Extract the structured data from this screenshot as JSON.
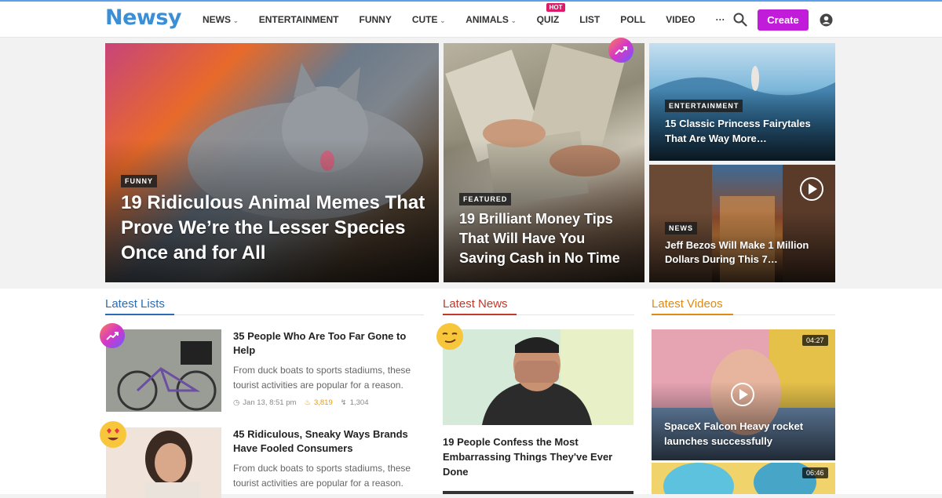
{
  "brand": {
    "logo": "Newsy",
    "accent": "#c11cd9"
  },
  "nav": {
    "items": [
      {
        "label": "NEWS",
        "dropdown": true
      },
      {
        "label": "ENTERTAINMENT",
        "dropdown": false
      },
      {
        "label": "FUNNY",
        "dropdown": false
      },
      {
        "label": "CUTE",
        "dropdown": true
      },
      {
        "label": "ANIMALS",
        "dropdown": true
      },
      {
        "label": "QUIZ",
        "dropdown": false,
        "badge": "HOT"
      },
      {
        "label": "LIST",
        "dropdown": false
      },
      {
        "label": "POLL",
        "dropdown": false
      },
      {
        "label": "VIDEO",
        "dropdown": false
      },
      {
        "label": "···",
        "dropdown": false
      }
    ],
    "create_label": "Create"
  },
  "featured": [
    {
      "category": "FUNNY",
      "title": "19 Ridiculous Animal Memes That Prove We’re the Lesser Species Once and for All"
    },
    {
      "category": "FEATURED",
      "title": "19 Brilliant Money Tips That Will Have You Saving Cash in No Time",
      "icon": "trending-icon"
    },
    {
      "category": "ENTERTAINMENT",
      "title": "15 Classic Princess Fairytales That Are Way More…"
    },
    {
      "category": "NEWS",
      "title": "Jeff Bezos Will Make 1 Million Dollars During This 7…",
      "icon": "play-icon"
    }
  ],
  "sections": {
    "lists": {
      "title": "Latest Lists",
      "color": "#2a6bb8",
      "items": [
        {
          "title": "35 People Who Are Too Far Gone to Help",
          "desc": "From duck boats to sports stadiums, these tourist activities are popular for a reason.",
          "date": "Jan 13, 8:51 pm",
          "hot": "3,819",
          "shares": "1,304",
          "badge": "trending-icon"
        },
        {
          "title": "45 Ridiculous, Sneaky Ways Brands Have Fooled Consumers",
          "desc": "From duck boats to sports stadiums, these tourist activities are popular for a reason.",
          "badge": "heart-eyes-emoji-icon"
        }
      ]
    },
    "news": {
      "title": "Latest News",
      "color": "#c0392b",
      "items": [
        {
          "title": "19 People Confess the Most Embarrassing Things They've Ever Done",
          "badge": "smirk-emoji-icon"
        }
      ]
    },
    "videos": {
      "title": "Latest Videos",
      "color": "#e08a12",
      "items": [
        {
          "title": "SpaceX Falcon Heavy rocket launches successfully",
          "duration": "04:27"
        },
        {
          "title": "",
          "duration": "06:46"
        }
      ]
    }
  }
}
